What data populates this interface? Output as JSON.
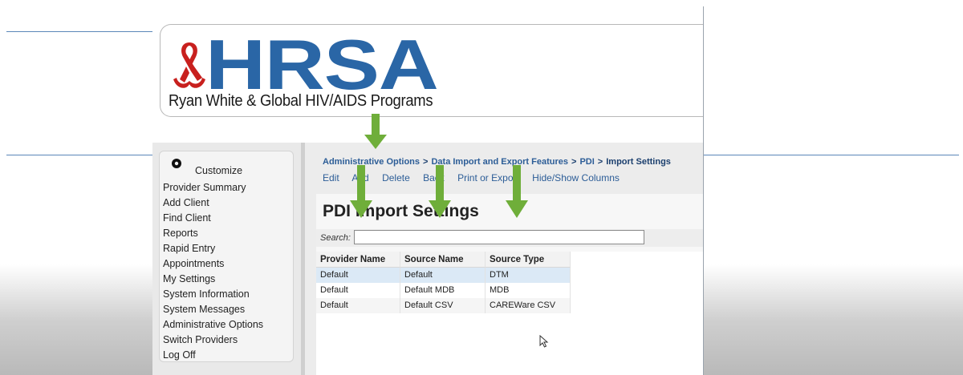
{
  "logo": {
    "letters": "HRSA",
    "subtitle": "Ryan White & Global HIV/AIDS Programs"
  },
  "sidebar": {
    "customize_label": "Customize",
    "items": [
      {
        "label": "Provider Summary"
      },
      {
        "label": "Add Client"
      },
      {
        "label": "Find Client"
      },
      {
        "label": "Reports"
      },
      {
        "label": "Rapid Entry"
      },
      {
        "label": "Appointments"
      },
      {
        "label": "My Settings"
      },
      {
        "label": "System Information"
      },
      {
        "label": "System Messages"
      },
      {
        "label": "Administrative Options"
      },
      {
        "label": "Switch Providers"
      },
      {
        "label": "Log Off"
      }
    ]
  },
  "breadcrumb": {
    "items": [
      "Administrative Options",
      "Data Import and Export Features",
      "PDI",
      "Import Settings"
    ],
    "separator": ">"
  },
  "toolbar": {
    "edit": "Edit",
    "add": "Add",
    "delete": "Delete",
    "back": "Back",
    "print_export": "Print or Export",
    "hide_show": "Hide/Show Columns"
  },
  "page": {
    "title": "PDI Import Settings",
    "search_label": "Search:",
    "search_value": ""
  },
  "table": {
    "headers": [
      "Provider Name",
      "Source Name",
      "Source Type"
    ],
    "rows": [
      [
        "Default",
        "Default",
        "DTM"
      ],
      [
        "Default",
        "Default MDB",
        "MDB"
      ],
      [
        "Default",
        "Default CSV",
        "CAREWare CSV"
      ]
    ],
    "selected_row": 0
  },
  "colors": {
    "brand_blue": "#2a66a6",
    "ribbon_red": "#c8201e",
    "link_blue": "#2c5d97",
    "arrow_green": "#6fae3a",
    "selected_row": "#dbe9f6"
  },
  "icons": {
    "gear": "gear-icon",
    "ribbon": "red-ribbon-logo-icon",
    "cursor": "mouse-pointer-icon",
    "annotation_arrow": "arrow-down-icon"
  }
}
